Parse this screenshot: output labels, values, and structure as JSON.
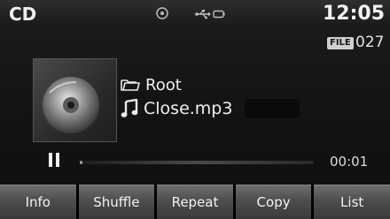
{
  "status_bar": {
    "mode": "CD",
    "clock": "12:05",
    "icons": [
      "disc-indicator-icon",
      "usb-indicator-icon"
    ]
  },
  "track": {
    "file_badge": "FILE",
    "file_number": "027",
    "folder": "Root",
    "file_name": "Close.mp3"
  },
  "playback": {
    "state": "paused",
    "elapsed": "00:01",
    "progress": 0.01
  },
  "softkeys": [
    "Info",
    "Shuffle",
    "Repeat",
    "Copy",
    "List"
  ]
}
